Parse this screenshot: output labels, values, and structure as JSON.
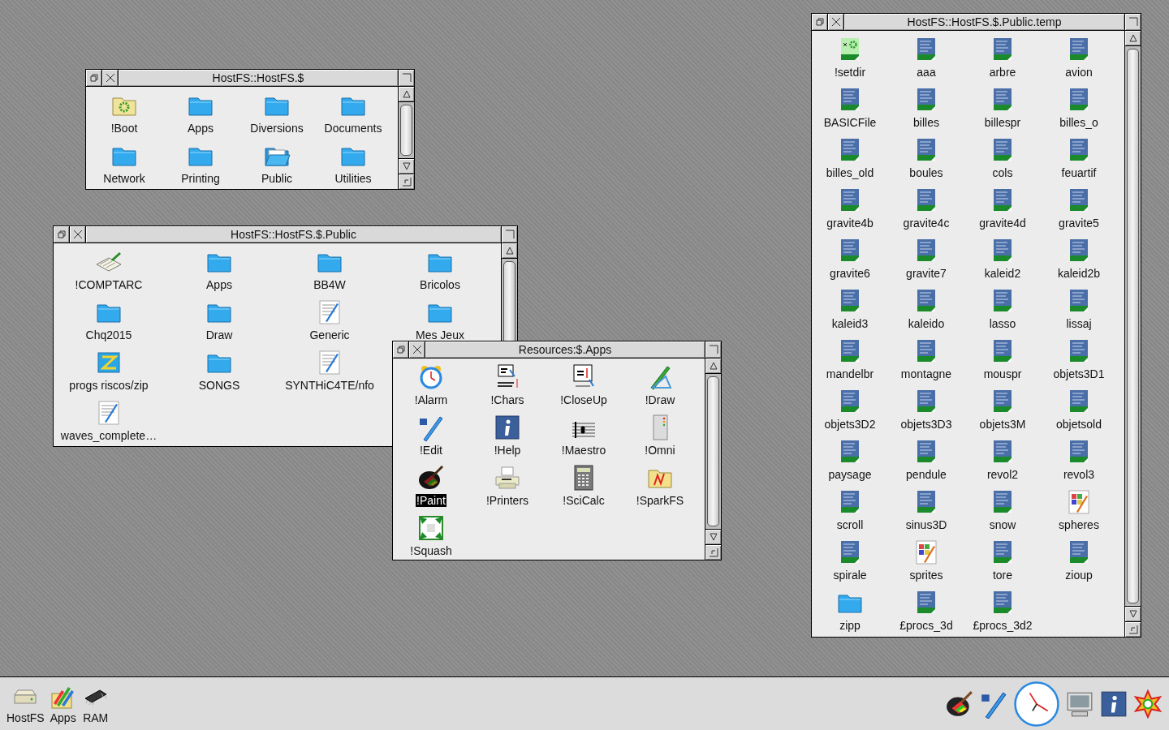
{
  "windows": [
    {
      "title": "HostFS::HostFS.$",
      "items": [
        {
          "label": "!Boot",
          "kind": "app-folder",
          "selected": false
        },
        {
          "label": "Apps",
          "kind": "folder",
          "selected": false
        },
        {
          "label": "Diversions",
          "kind": "folder",
          "selected": false
        },
        {
          "label": "Documents",
          "kind": "folder",
          "selected": false
        },
        {
          "label": "Network",
          "kind": "folder",
          "selected": false
        },
        {
          "label": "Printing",
          "kind": "folder",
          "selected": false
        },
        {
          "label": "Public",
          "kind": "open-folder",
          "selected": false
        },
        {
          "label": "Utilities",
          "kind": "folder",
          "selected": false
        }
      ]
    },
    {
      "title": "HostFS::HostFS.$.Public",
      "items": [
        {
          "label": "!COMPTARC",
          "kind": "book",
          "selected": false
        },
        {
          "label": "Apps",
          "kind": "folder",
          "selected": false
        },
        {
          "label": "BB4W",
          "kind": "folder",
          "selected": false
        },
        {
          "label": "Bricolos",
          "kind": "folder",
          "selected": false
        },
        {
          "label": "Chq2015",
          "kind": "folder",
          "selected": false
        },
        {
          "label": "Draw",
          "kind": "folder",
          "selected": false
        },
        {
          "label": "Generic",
          "kind": "drawfile",
          "selected": false
        },
        {
          "label": "Mes Jeux",
          "kind": "folder",
          "selected": false
        },
        {
          "label": "progs riscos/zip",
          "kind": "archive",
          "selected": false
        },
        {
          "label": "SONGS",
          "kind": "folder",
          "selected": false
        },
        {
          "label": "SYNTHiC4TE/nfo",
          "kind": "drawfile",
          "selected": false
        },
        {
          "label": "waves_complete…",
          "kind": "drawfile",
          "selected": false
        }
      ]
    },
    {
      "title": "Resources:$.Apps",
      "items": [
        {
          "label": "!Alarm",
          "kind": "alarm",
          "selected": false
        },
        {
          "label": "!Chars",
          "kind": "chars",
          "selected": false
        },
        {
          "label": "!CloseUp",
          "kind": "closeup",
          "selected": false
        },
        {
          "label": "!Draw",
          "kind": "draw",
          "selected": false
        },
        {
          "label": "!Edit",
          "kind": "edit",
          "selected": false
        },
        {
          "label": "!Help",
          "kind": "help",
          "selected": false
        },
        {
          "label": "!Maestro",
          "kind": "maestro",
          "selected": false
        },
        {
          "label": "!Omni",
          "kind": "omni",
          "selected": false
        },
        {
          "label": "!Paint",
          "kind": "paint",
          "selected": true
        },
        {
          "label": "!Printers",
          "kind": "printers",
          "selected": false
        },
        {
          "label": "!SciCalc",
          "kind": "scicalc",
          "selected": false
        },
        {
          "label": "!SparkFS",
          "kind": "sparkfs",
          "selected": false
        },
        {
          "label": "!Squash",
          "kind": "squash",
          "selected": false
        }
      ]
    },
    {
      "title": "HostFS::HostFS.$.Public.temp",
      "items": [
        {
          "label": "!setdir",
          "kind": "obey",
          "selected": false
        },
        {
          "label": "aaa",
          "kind": "basic",
          "selected": false
        },
        {
          "label": "arbre",
          "kind": "basic",
          "selected": false
        },
        {
          "label": "avion",
          "kind": "basic",
          "selected": false
        },
        {
          "label": "BASICFile",
          "kind": "basic",
          "selected": false
        },
        {
          "label": "billes",
          "kind": "basic",
          "selected": false
        },
        {
          "label": "billespr",
          "kind": "basic",
          "selected": false
        },
        {
          "label": "billes_o",
          "kind": "basic",
          "selected": false
        },
        {
          "label": "billes_old",
          "kind": "basic",
          "selected": false
        },
        {
          "label": "boules",
          "kind": "basic",
          "selected": false
        },
        {
          "label": "cols",
          "kind": "basic",
          "selected": false
        },
        {
          "label": "feuartif",
          "kind": "basic",
          "selected": false
        },
        {
          "label": "gravite4b",
          "kind": "basic",
          "selected": false
        },
        {
          "label": "gravite4c",
          "kind": "basic",
          "selected": false
        },
        {
          "label": "gravite4d",
          "kind": "basic",
          "selected": false
        },
        {
          "label": "gravite5",
          "kind": "basic",
          "selected": false
        },
        {
          "label": "gravite6",
          "kind": "basic",
          "selected": false
        },
        {
          "label": "gravite7",
          "kind": "basic",
          "selected": false
        },
        {
          "label": "kaleid2",
          "kind": "basic",
          "selected": false
        },
        {
          "label": "kaleid2b",
          "kind": "basic",
          "selected": false
        },
        {
          "label": "kaleid3",
          "kind": "basic",
          "selected": false
        },
        {
          "label": "kaleido",
          "kind": "basic",
          "selected": false
        },
        {
          "label": "lasso",
          "kind": "basic",
          "selected": false
        },
        {
          "label": "lissaj",
          "kind": "basic",
          "selected": false
        },
        {
          "label": "mandelbr",
          "kind": "basic",
          "selected": false
        },
        {
          "label": "montagne",
          "kind": "basic",
          "selected": false
        },
        {
          "label": "mouspr",
          "kind": "basic",
          "selected": false
        },
        {
          "label": "objets3D1",
          "kind": "basic",
          "selected": false
        },
        {
          "label": "objets3D2",
          "kind": "basic",
          "selected": false
        },
        {
          "label": "objets3D3",
          "kind": "basic",
          "selected": false
        },
        {
          "label": "objets3M",
          "kind": "basic",
          "selected": false
        },
        {
          "label": "objetsold",
          "kind": "basic",
          "selected": false
        },
        {
          "label": "paysage",
          "kind": "basic",
          "selected": false
        },
        {
          "label": "pendule",
          "kind": "basic",
          "selected": false
        },
        {
          "label": "revol2",
          "kind": "basic",
          "selected": false
        },
        {
          "label": "revol3",
          "kind": "basic",
          "selected": false
        },
        {
          "label": "scroll",
          "kind": "basic",
          "selected": false
        },
        {
          "label": "sinus3D",
          "kind": "basic",
          "selected": false
        },
        {
          "label": "snow",
          "kind": "basic",
          "selected": false
        },
        {
          "label": "spheres",
          "kind": "sprite",
          "selected": false
        },
        {
          "label": "spirale",
          "kind": "basic",
          "selected": false
        },
        {
          "label": "sprites",
          "kind": "sprite",
          "selected": false
        },
        {
          "label": "tore",
          "kind": "basic",
          "selected": false
        },
        {
          "label": "zioup",
          "kind": "basic",
          "selected": false
        },
        {
          "label": "zipp",
          "kind": "folder",
          "selected": false
        },
        {
          "label": "£procs_3d",
          "kind": "basic",
          "selected": false
        },
        {
          "label": "£procs_3d2",
          "kind": "basic",
          "selected": false
        }
      ]
    }
  ],
  "iconbar": {
    "left": [
      {
        "label": "HostFS",
        "kind": "drive"
      },
      {
        "label": "Apps",
        "kind": "apps"
      },
      {
        "label": "RAM",
        "kind": "ram"
      }
    ],
    "right": [
      {
        "kind": "paint"
      },
      {
        "kind": "edit"
      },
      {
        "kind": "clock"
      },
      {
        "kind": "display"
      },
      {
        "kind": "help"
      },
      {
        "kind": "star"
      }
    ]
  }
}
